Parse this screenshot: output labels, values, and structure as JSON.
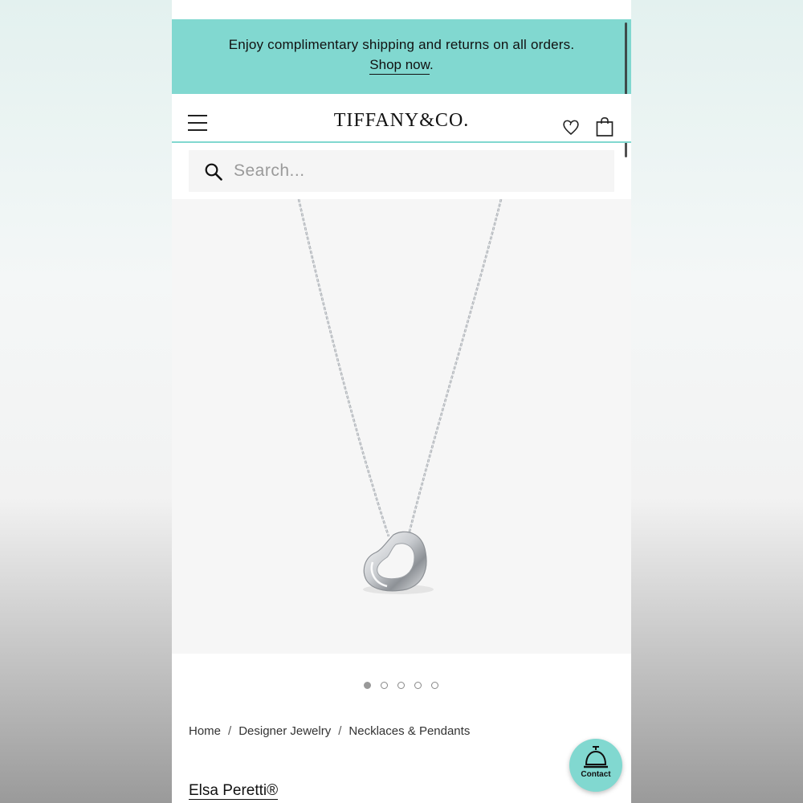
{
  "promo_banner": {
    "message": "Enjoy complimentary shipping and returns on all orders.",
    "link_label": "Shop now",
    "link_suffix": "."
  },
  "header": {
    "logo_text": "TIFFANY&CO.",
    "menu_icon": "hamburger-menu-icon",
    "wishlist_icon": "heart-icon",
    "bag_icon": "shopping-bag-icon"
  },
  "search": {
    "placeholder": "Search...",
    "value": "",
    "icon": "search-icon"
  },
  "product_image": {
    "description_icon": "heart-pendant-necklace",
    "carousel_count": 5,
    "carousel_active_index": 0
  },
  "breadcrumb": {
    "items": [
      "Home",
      "Designer Jewelry",
      "Necklaces & Pendants"
    ],
    "separator": "/"
  },
  "product": {
    "designer": "Elsa Peretti®"
  },
  "contact_button": {
    "label": "Contact",
    "icon": "concierge-bell-icon"
  },
  "colors": {
    "brand_blue": "#81d8d0",
    "text": "#111111",
    "image_bg": "#f6f6f6"
  }
}
